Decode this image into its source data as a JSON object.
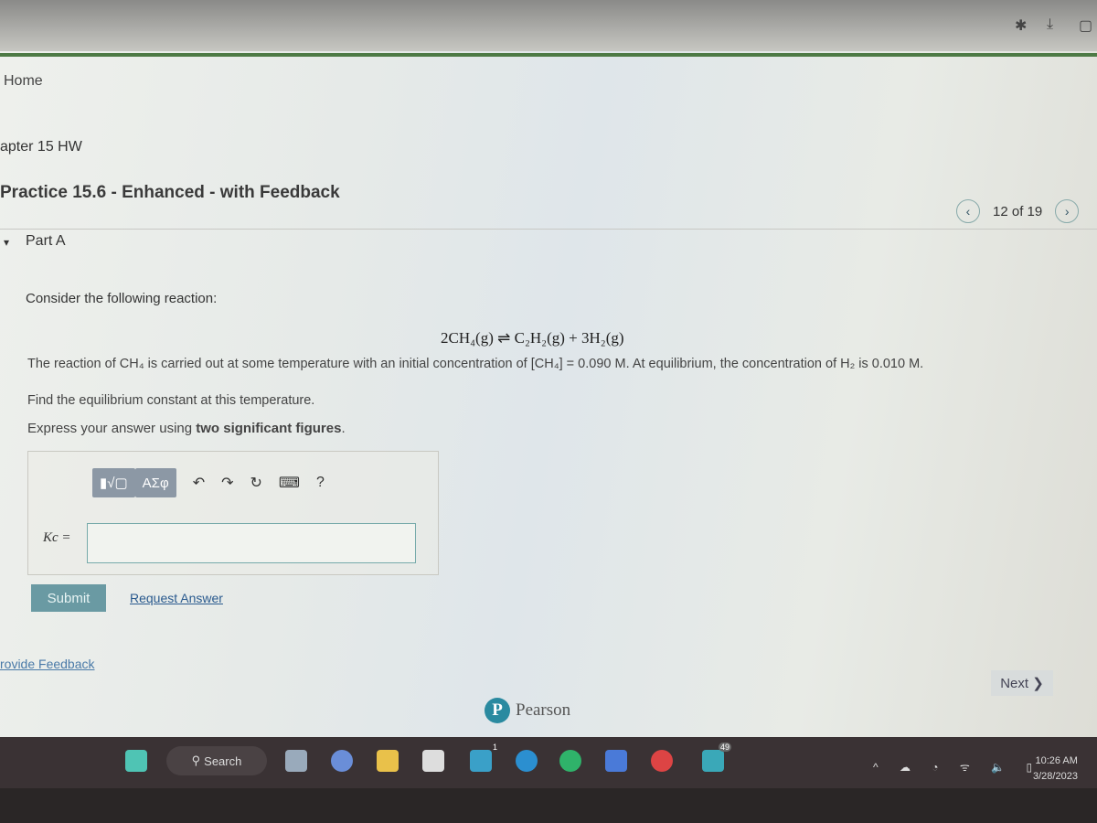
{
  "breadcrumb": {
    "home": "Home",
    "chapter": "apter 15 HW"
  },
  "assignment": {
    "title": "Practice 15.6 - Enhanced - with Feedback",
    "position": "12 of 19",
    "prev_icon": "chevron-left-icon",
    "next_icon": "chevron-right-icon"
  },
  "part": {
    "label": "Part A"
  },
  "question": {
    "intro": "Consider the following reaction:",
    "equation": "2CH₄(g) ⇌ C₂H₂(g) + 3H₂(g)",
    "body": "The reaction of CH₄ is carried out at some temperature with an initial concentration of [CH₄] = 0.090 M. At equilibrium, the concentration of H₂ is 0.010 M.",
    "task": "Find the equilibrium constant at this temperature.",
    "instruction": "Express your answer using two significant figures."
  },
  "answer": {
    "label": "Kc =",
    "value": "",
    "toolbar": {
      "templates": "▮√▢",
      "symbols": "ΑΣφ",
      "undo": "↶",
      "redo": "↷",
      "reset": "↻",
      "keyboard": "⌨",
      "help": "?"
    }
  },
  "actions": {
    "submit": "Submit",
    "request": "Request Answer",
    "feedback": "rovide Feedback",
    "next": "Next ❯"
  },
  "footer": {
    "brand": "Pearson",
    "logo": "P"
  },
  "taskbar": {
    "search": "Search",
    "mail_badge": "1",
    "app_badge": "49",
    "time": "10:26 AM",
    "date": "3/28/2023"
  }
}
